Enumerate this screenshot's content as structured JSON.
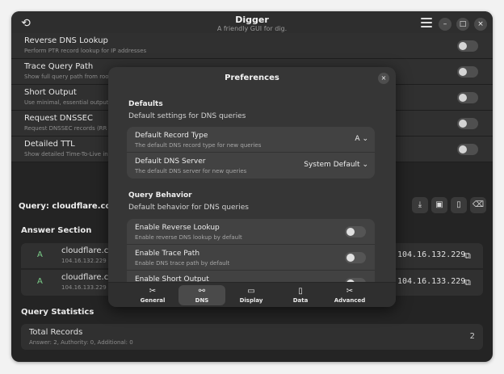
{
  "window": {
    "title": "Digger",
    "subtitle": "A friendly GUI for dig.",
    "controls": {
      "minimize": "–",
      "maximize": "□",
      "close": "×"
    }
  },
  "background_settings": [
    {
      "title": "Reverse DNS Lookup",
      "subtitle": "Perform PTR record lookup for IP addresses"
    },
    {
      "title": "Trace Query Path",
      "subtitle": "Show full query path from roo"
    },
    {
      "title": "Short Output",
      "subtitle": "Use minimal, essential output"
    },
    {
      "title": "Request DNSSEC",
      "subtitle": "Request DNSSEC records (RR"
    },
    {
      "title": "Detailed TTL",
      "subtitle": "Show detailed Time-To-Live in"
    }
  ],
  "query": {
    "title": "Query: cloudflare.com (A)",
    "answer_section_label": "Answer Section",
    "answers": [
      {
        "type": "A",
        "name": "cloudflare.cor",
        "ip_sub": "104.16.132.229",
        "value": "104.16.132.229"
      },
      {
        "type": "A",
        "name": "cloudflare.cor",
        "ip_sub": "104.16.133.229",
        "value": "104.16.133.229"
      }
    ],
    "stats_label": "Query Statistics",
    "total_records_label": "Total Records",
    "total_records_sub": "Answer: 2, Authority: 0, Additional: 0",
    "total_records_value": "2"
  },
  "dialog": {
    "title": "Preferences",
    "close": "×",
    "defaults": {
      "title": "Defaults",
      "subtitle": "Default settings for DNS queries",
      "record_type": {
        "title": "Default Record Type",
        "subtitle": "The default DNS record type for new queries",
        "value": "A"
      },
      "dns_server": {
        "title": "Default DNS Server",
        "subtitle": "The default DNS server for new queries",
        "value": "System Default"
      }
    },
    "behavior": {
      "title": "Query Behavior",
      "subtitle": "Default behavior for DNS queries",
      "reverse": {
        "title": "Enable Reverse Lookup",
        "subtitle": "Enable reverse DNS lookup by default"
      },
      "trace": {
        "title": "Enable Trace Path",
        "subtitle": "Enable DNS trace path by default"
      },
      "short": {
        "title": "Enable Short Output",
        "subtitle": ""
      }
    },
    "tabs": [
      {
        "label": "General",
        "icon": "tools-icon",
        "glyph": "✂"
      },
      {
        "label": "DNS",
        "icon": "network-icon",
        "glyph": "⚯"
      },
      {
        "label": "Display",
        "icon": "monitor-icon",
        "glyph": "▭"
      },
      {
        "label": "Data",
        "icon": "document-icon",
        "glyph": "▯"
      },
      {
        "label": "Advanced",
        "icon": "advanced-tools-icon",
        "glyph": "✂"
      }
    ],
    "active_tab": "DNS"
  }
}
